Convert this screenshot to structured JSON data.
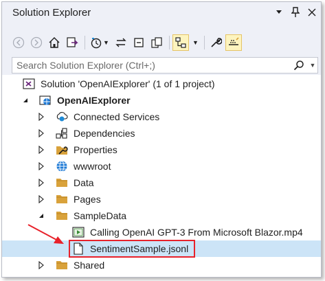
{
  "window": {
    "title": "Solution Explorer",
    "colors": {
      "accent_red": "#e8212a",
      "selection": "#cce4f7",
      "folder": "#d9a23b",
      "solution_purple": "#68217a"
    }
  },
  "search": {
    "placeholder": "Search Solution Explorer (Ctrl+;)"
  },
  "tree": {
    "items": [
      {
        "label": "Solution 'OpenAIExplorer' (1 of 1 project)",
        "icon": "solution-icon",
        "expander": "none"
      },
      {
        "label": "OpenAIExplorer",
        "icon": "web-project-icon",
        "expander": "expanded"
      },
      {
        "label": "Connected Services",
        "icon": "connected-services-icon",
        "expander": "collapsed"
      },
      {
        "label": "Dependencies",
        "icon": "dependencies-icon",
        "expander": "collapsed"
      },
      {
        "label": "Properties",
        "icon": "properties-wrench-icon",
        "expander": "collapsed"
      },
      {
        "label": "wwwroot",
        "icon": "globe-icon",
        "expander": "collapsed"
      },
      {
        "label": "Data",
        "icon": "folder-icon",
        "expander": "collapsed"
      },
      {
        "label": "Pages",
        "icon": "folder-icon",
        "expander": "collapsed"
      },
      {
        "label": "SampleData",
        "icon": "folder-icon",
        "expander": "expanded"
      },
      {
        "label": "Calling OpenAI GPT-3 From Microsoft Blazor.mp4",
        "icon": "video-file-icon",
        "expander": "none"
      },
      {
        "label": "SentimentSample.jsonl",
        "icon": "file-icon",
        "expander": "none",
        "selected": true
      },
      {
        "label": "Shared",
        "icon": "folder-icon",
        "expander": "collapsed"
      }
    ]
  }
}
